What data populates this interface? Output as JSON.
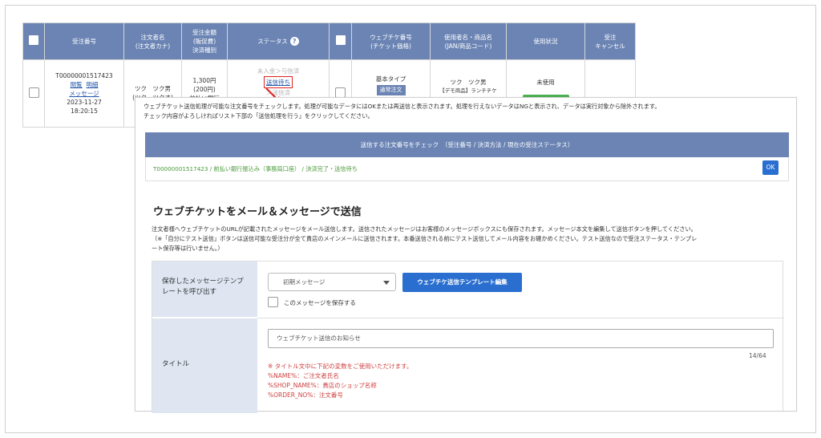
{
  "table": {
    "headers": {
      "order_no": "受注番号",
      "orderer": [
        "注文者名",
        "(注文者カナ)"
      ],
      "amount": [
        "受注金額",
        "(販促費)",
        "決済種別"
      ],
      "status": "ステータス",
      "ticket_no": [
        "ウェブチケ番号",
        "(チケット価格)"
      ],
      "user_product": [
        "使用者名・商品名",
        "(JAN/商品コード)"
      ],
      "usage": "使用状況",
      "cancel": [
        "受注",
        "キャンセル"
      ]
    },
    "row": {
      "order_no": "T00000001517423",
      "links": [
        "閲覧",
        "明細"
      ],
      "message_link": "メッセージ",
      "date": "2023-11-27",
      "time": "18:20:15",
      "orderer_name": "ツク　ツク男",
      "orderer_kana": "(ツク　ツクオ)",
      "amount": "1,300円",
      "promo": "(200円)",
      "payment_type": "前払い銀行",
      "status_prev": "未入金＞与信済",
      "status_current": "送信待ち",
      "status_next": "＞送信済",
      "ticket_type": "基本タイプ",
      "ticket_chip": "通常注文",
      "user_name": "ツク　ツク男",
      "product": "【デモ商品】ランチチケ",
      "usage": "未使用"
    }
  },
  "panel": {
    "intro_line1": "ウェブチケット送信処理が可能な注文番号をチェックします。処理が可能なデータにはOKまたは再送信と表示されます。処理を行えないデータはNGと表示され、データは実行対象から除外されます。",
    "intro_line2": "チェック内容がよろしければリスト下部の「送信処理を行う」をクリックしてください。",
    "check_header": "送信する注文番号をチェック　（受注番号 / 決済方法 / 現在の受注ステータス）",
    "check_row": "T00000001517423 / 前払い銀行振込み（事務局口座） / 決済完了・送信待ち",
    "ok_label": "OK",
    "section_title": "ウェブチケットをメール＆メッセージで送信",
    "desc_line1": "注文者様へウェブチケットのURLが記載されたメッセージをメール送信します。送信されたメッセージはお客様のメッセージボックスにも保存されます。メッセージ本文を編集して送信ボタンを押してください。",
    "desc_line2": "（※「自分にテスト送信」ボタンは送信可能な受注分が全て貴店のメインメールに送信されます。本番送信される前にテスト送信してメール内容をお確かめください。テスト送信なので受注ステータス・テンプレ",
    "desc_line3": "ート保存等は行いません。）",
    "form": {
      "template_label": [
        "保存したメッセージテンプ",
        "レートを呼び出す"
      ],
      "select_value": "初期メッセージ",
      "template_edit_button": "ウェブチケ送信テンプレート編集",
      "save_label": "このメッセージを保存する",
      "title_label": "タイトル",
      "title_value": "ウェブチケット送信のお知らせ",
      "counter": "14/64",
      "notes": [
        "※ タイトル文中に下記の変数をご使用いただけます。",
        "%NAME%：ご注文者氏名",
        "%SHOP_NAME%：貴店のショップ名称",
        "%ORDER_NO%：注文番号"
      ]
    }
  },
  "colors": {
    "header_blue": "#6b84b4",
    "button_blue": "#2a6fd0",
    "highlight_red": "#e02020",
    "ok_green_text": "#4a9a3a",
    "note_red": "#d04040"
  }
}
